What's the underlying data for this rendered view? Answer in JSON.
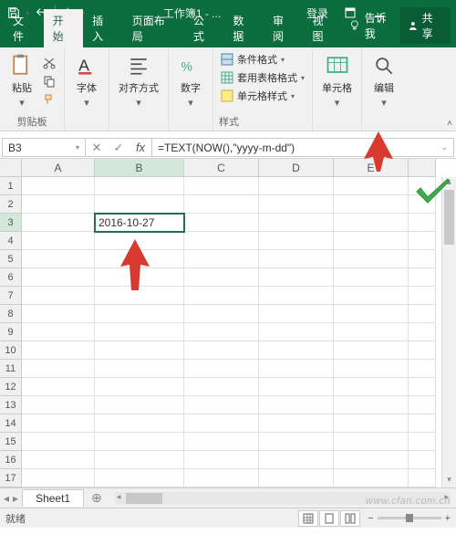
{
  "titlebar": {
    "title": "工作簿1 - ...",
    "login": "登录"
  },
  "tabs": {
    "file": "文件",
    "home": "开始",
    "insert": "插入",
    "pagelayout": "页面布局",
    "formulas": "公式",
    "data": "数据",
    "review": "审阅",
    "view": "视图",
    "tellme": "告诉我",
    "share": "共享"
  },
  "ribbon": {
    "clipboard": {
      "paste": "粘贴",
      "label": "剪贴板"
    },
    "font": {
      "btn": "字体"
    },
    "align": {
      "btn": "对齐方式"
    },
    "number": {
      "btn": "数字"
    },
    "styles": {
      "cond": "条件格式",
      "table": "套用表格格式",
      "cell": "单元格样式",
      "label": "样式"
    },
    "cells": {
      "btn": "单元格"
    },
    "editing": {
      "btn": "编辑"
    }
  },
  "nameBox": "B3",
  "formula": "=TEXT(NOW(),\"yyyy-m-dd\")",
  "columns": [
    "A",
    "B",
    "C",
    "D",
    "E"
  ],
  "rows": [
    "1",
    "2",
    "3",
    "4",
    "5",
    "6",
    "7",
    "8",
    "9",
    "10",
    "11",
    "12",
    "13",
    "14",
    "15",
    "16",
    "17"
  ],
  "cells": {
    "B3": "2016-10-27"
  },
  "activeCell": "B3",
  "sheetTab": "Sheet1",
  "status": {
    "ready": "就绪"
  },
  "watermark": "www.cfan.com.cn"
}
